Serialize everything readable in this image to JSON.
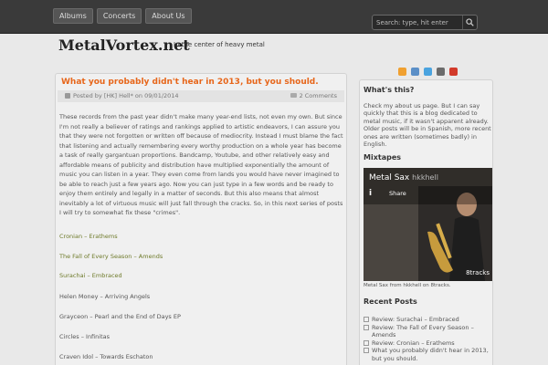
{
  "nav": {
    "items": [
      {
        "label": "Albums"
      },
      {
        "label": "Concerts"
      },
      {
        "label": "About Us"
      }
    ]
  },
  "search": {
    "placeholder": "Search: type, hit enter"
  },
  "header": {
    "title": "MetalVortex.net",
    "tagline": "In the center of heavy metal"
  },
  "post": {
    "title": "What you probably didn't hear in 2013, but you should.",
    "meta": "Posted by [HK] Hell* on 09/01/2014",
    "comments": "2 Comments",
    "body": "These records from the past year didn't make many year-end lists, not even my own. But since I'm not really a believer of ratings and rankings applied to artistic endeavors, I can assure you that they were not forgotten or written off because of mediocrity. Instead I must blame the fact that listening and actually remembering every worthy production on a whole year has become a task of really gargantuan proportions. Bandcamp, Youtube, and other relatively easy and affordable means of publicity and distribution have multiplied exponentially the amount of music you can listen in a year. They even come from lands you would have never imagined to be able to reach just a few years ago. Now you can just type in a few words and be ready to enjoy them entirely and legally in a matter of seconds. But this also means that almost inevitably a lot of virtuous music will just fall through the cracks. So, in this next series of posts I will try to somewhat fix these \"crimes\".",
    "entries": [
      {
        "label": "Cronian – Erathems",
        "link": true
      },
      {
        "label": "The Fall of Every Season – Amends",
        "link": true
      },
      {
        "label": "Surachai – Embraced",
        "link": true
      },
      {
        "label": "Helen Money – Arriving Angels",
        "link": false
      },
      {
        "label": "Grayceon – Pearl and the End of Days EP",
        "link": false
      },
      {
        "label": "Circles – Infinitas",
        "link": false
      },
      {
        "label": "Craven Idol – Towards Eschaton",
        "link": false
      }
    ]
  },
  "sidebar": {
    "about_title": "What's this?",
    "about_text": "Check my about us page. But I can say quickly that this is a blog dedicated to metal music, if it wasn't apparent already. Older posts will be in Spanish, more recent ones are written (sometimes badly) in English.",
    "mixtapes_title": "Mixtapes",
    "player": {
      "title": "Metal Sax",
      "user": "hkkhell",
      "share": "Share",
      "brand": "8tracks"
    },
    "player_caption": "Metal Sax from hkkhell on 8tracks.",
    "recent_title": "Recent Posts",
    "recent": [
      {
        "label": "Review: Surachai – Embraced"
      },
      {
        "label": "Review: The Fall of Every Season – Amends"
      },
      {
        "label": "Review: Cronian – Erathems"
      },
      {
        "label": "What you probably didn't hear in 2013, but you should."
      }
    ]
  },
  "colors": {
    "accent": "#e7661a",
    "link": "#6e7a2a",
    "topbar": "#3a3a3a"
  }
}
